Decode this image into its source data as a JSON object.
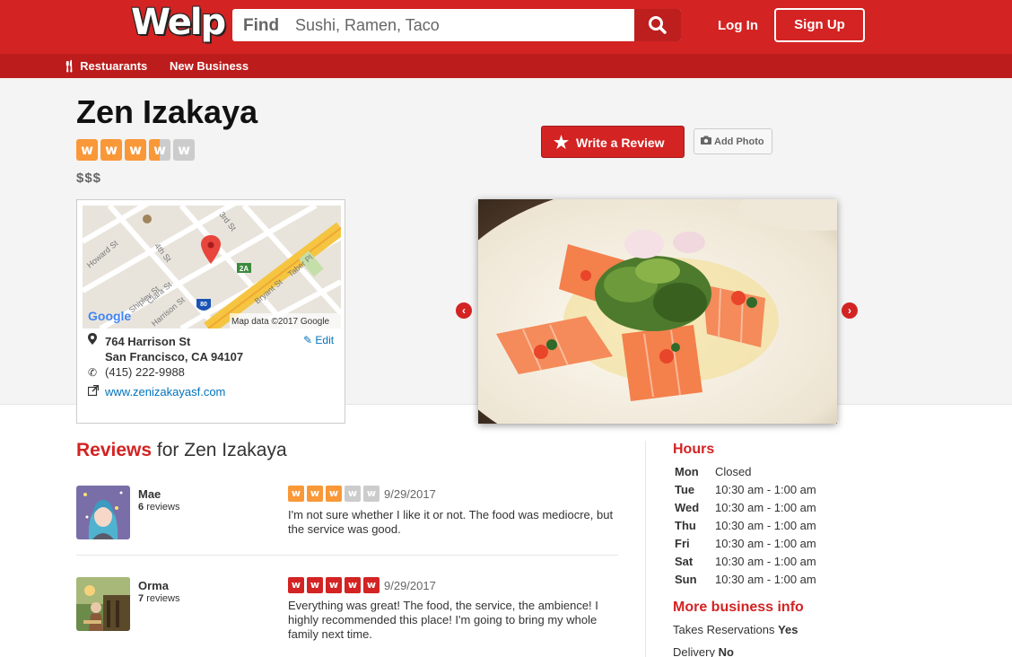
{
  "header": {
    "logo": "Welp",
    "search_label": "Find",
    "search_placeholder": "Sushi, Ramen, Taco",
    "login": "Log In",
    "signup": "Sign Up"
  },
  "subnav": {
    "restaurants": "Restuarants",
    "new_business": "New Business"
  },
  "business": {
    "name": "Zen Izakaya",
    "rating": 3.5,
    "price": "$$$",
    "write_review": "Write a Review",
    "add_photo": "Add Photo",
    "address_line1": "764 Harrison St",
    "address_line2": "San Francisco, CA 94107",
    "phone": "(415) 222-9988",
    "website": "www.zenizakayasf.com",
    "edit": "Edit",
    "map_credit": "Map data ©2017 Google",
    "map_logo": "Google",
    "map_streets": [
      "Howard St",
      "4th St",
      "3rd St",
      "Shipley St",
      "Clara St",
      "Harrison St",
      "Bryant St",
      "Taber Pl"
    ],
    "map_highway_shields": [
      "80",
      "2A"
    ]
  },
  "reviews": {
    "title_prefix": "Reviews",
    "title_suffix": " for Zen Izakaya",
    "items": [
      {
        "name": "Mae",
        "count": "6",
        "count_label": "reviews",
        "rating": 3,
        "date": "9/29/2017",
        "text": "I'm not sure whether I like it or not. The food was mediocre, but the service was good."
      },
      {
        "name": "Orma",
        "count": "7",
        "count_label": "reviews",
        "rating": 5,
        "date": "9/29/2017",
        "text": "Everything was great! The food, the service, the ambience! I highly recommended this place! I'm going to bring my whole family next time."
      }
    ]
  },
  "hours": {
    "title": "Hours",
    "rows": [
      {
        "day": "Mon",
        "time": "Closed"
      },
      {
        "day": "Tue",
        "time": "10:30 am - 1:00 am"
      },
      {
        "day": "Wed",
        "time": "10:30 am - 1:00 am"
      },
      {
        "day": "Thu",
        "time": "10:30 am - 1:00 am"
      },
      {
        "day": "Fri",
        "time": "10:30 am - 1:00 am"
      },
      {
        "day": "Sat",
        "time": "10:30 am - 1:00 am"
      },
      {
        "day": "Sun",
        "time": "10:30 am - 1:00 am"
      }
    ]
  },
  "more_info": {
    "title": "More business info",
    "items": [
      {
        "label": "Takes Reservations",
        "value": "Yes"
      },
      {
        "label": "Delivery",
        "value": "No"
      }
    ]
  },
  "colors": {
    "brand": "#d32323",
    "star_orange": "#f99838",
    "star_red": "#d32323",
    "star_empty": "#cccccc",
    "link": "#0073bb"
  },
  "icons": {
    "search": "search-icon",
    "star": "star-icon",
    "camera": "camera-icon",
    "pin": "map-pin-icon",
    "phone": "phone-icon",
    "external": "external-link-icon",
    "pencil": "pencil-icon",
    "fork": "fork-knife-icon"
  }
}
